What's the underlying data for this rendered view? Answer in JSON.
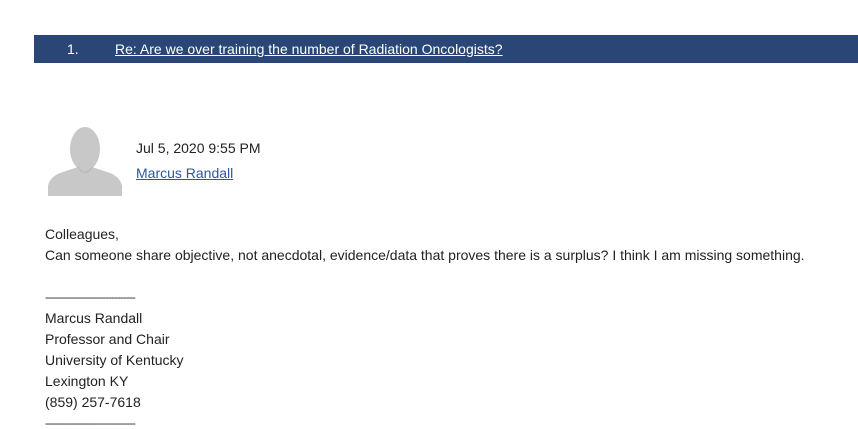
{
  "thread": {
    "number": "1.",
    "title": "Re: Are we over training the number of Radiation Oncologists?"
  },
  "post": {
    "date": "Jul 5, 2020 9:55 PM",
    "author": "Marcus Randall",
    "body": {
      "greeting": "Colleagues,",
      "message": "Can someone share objective, not anecdotal, evidence/data that proves there is a surplus?  I think I am missing something."
    },
    "signature": {
      "divider_top": "------------------------------",
      "name": "Marcus Randall",
      "title": "Professor and Chair",
      "organization": "University of Kentucky",
      "location": "Lexington KY",
      "phone": "(859) 257-7618",
      "divider_bottom": "------------------------------"
    }
  },
  "colors": {
    "header_bg": "#2a4677",
    "link": "#2a57a8",
    "avatar": "#c8c8c8"
  }
}
